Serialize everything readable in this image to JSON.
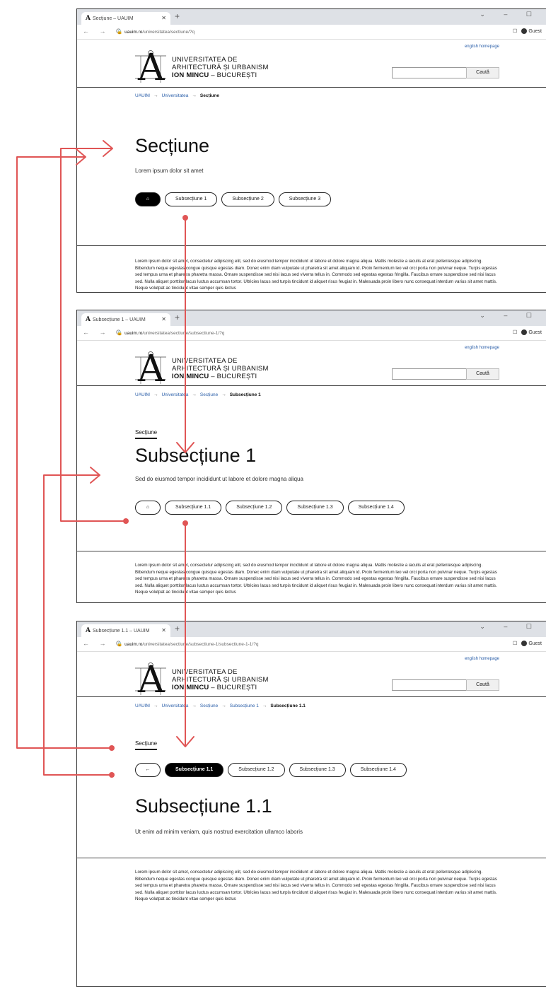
{
  "common": {
    "new_tab": "+",
    "window_controls": "⌄ – ☐",
    "nav_buttons": "← → C",
    "profile": "Guest",
    "english_link": "english homepage",
    "logo_letter": "A",
    "uni_line1": "UNIVERSITATEA DE",
    "uni_line2": "ARHITECTURĂ ȘI URBANISM",
    "uni_line3_bold": "ION MINCU",
    "uni_line3_rest": " – BUCUREȘTI",
    "search_button": "Caută",
    "home_icon": "home-icon",
    "back_icon": "back-arrow-icon",
    "arrow_sep": "→",
    "lorem": "Lorem ipsum dolor sit amet, consectetur adipiscing elit, sed do eiusmod tempor incididunt ut labore et dolore magna aliqua. Mattis molestie a iaculis at erat pellentesque adipiscing. Bibendum neque egestas congue quisque egestas diam. Donec enim diam vulputate ut pharetra sit amet aliquam id. Proin fermentum leo vel orci porta non pulvinar neque. Turpis egestas sed tempus urna et pharetra pharetra massa. Ornare suspendisse sed nisi lacus sed viverra tellus in. Commodo sed egestas egestas fringilla. Faucibus ornare suspendisse sed nisi lacus sed. Nulla aliquet porttitor lacus luctus accumsan tortor. Ultricies lacus sed turpis tincidunt id aliquet risus feugiat in. Malesuada proin libero nunc consequat interdum varius sit amet mattis. Neque volutpat ac tincidunt vitae semper quis lectus"
  },
  "screens": [
    {
      "tab_title": "Secțiune – UAUIM",
      "url_host": "uauim.ro",
      "url_path": "/universitatea/sectiune/?q",
      "crumbs": [
        "UAUIM",
        "Universitatea"
      ],
      "crumb_current": "Secțiune",
      "title": "Secțiune",
      "subtitle": "Lorem ipsum dolor sit amet",
      "pills": [
        "Subsecțiune 1",
        "Subsecțiune 2",
        "Subsecțiune 3"
      ]
    },
    {
      "tab_title": "Subsecțiune 1 – UAUIM",
      "url_host": "uauim.ro",
      "url_path": "/universitatea/sectiune/subsectiune-1/?q",
      "crumbs": [
        "UAUIM",
        "Universitatea",
        "Secțiune"
      ],
      "crumb_current": "Subsecțiune 1",
      "parent": "Secțiune",
      "title": "Subsecțiune 1",
      "subtitle": "Sed do eiusmod tempor incididunt ut labore et dolore magna aliqua",
      "pills": [
        "Subsecțiune 1.1",
        "Subsecțiune 1.2",
        "Subsecțiune 1.3",
        "Subsecțiune 1.4"
      ]
    },
    {
      "tab_title": "Subsecțiune 1.1 – UAUIM",
      "url_host": "uauim.ro",
      "url_path": "/universitatea/sectiune/subsectiune-1/subsectiune-1-1/?q",
      "crumbs": [
        "UAUIM",
        "Universitatea",
        "Secțiune",
        "Subsecțiune 1"
      ],
      "crumb_current": "Subsecțiune 1.1",
      "parent": "Secțiune",
      "pill_active": "Subsecțiune 1.1",
      "pills": [
        "Subsecțiune 1.2",
        "Subsecțiune 1.3",
        "Subsecțiune 1.4"
      ],
      "title": "Subsecțiune 1.1",
      "subtitle": "Ut enim ad minim veniam, quis nostrud exercitation ullamco laboris"
    }
  ],
  "colors": {
    "annotation": "#e05555",
    "link": "#2a5ea8"
  }
}
